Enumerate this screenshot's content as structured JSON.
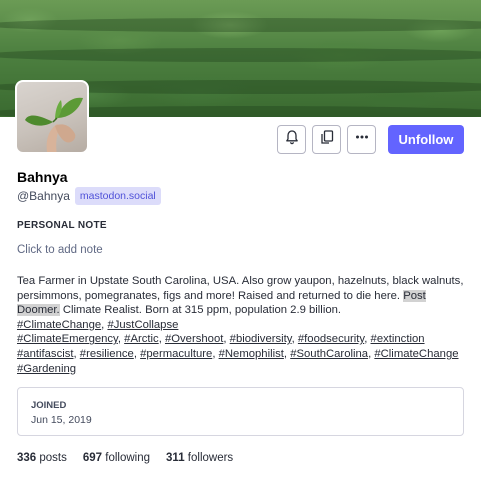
{
  "profile": {
    "display_name": "Bahnya",
    "handle": "@Bahnya",
    "domain": "mastodon.social"
  },
  "actions": {
    "bell_icon": "bell-icon",
    "copy_icon": "copy-icon",
    "more_icon": "ellipsis-icon",
    "unfollow_label": "Unfollow",
    "accent_color": "#6364ff"
  },
  "note": {
    "label": "PERSONAL NOTE",
    "placeholder": "Click to add note"
  },
  "bio": {
    "text_1": "Tea Farmer in Upstate South Carolina, USA. Also grow yaupon, hazelnuts, black walnuts, persimmons, pomegranates, figs and more! Raised and returned to die here.",
    "highlight": "Post Doomer.",
    "text_2": "Climate Realist. Born at 315 ppm, population 2.9 billion.",
    "hashtags_line1": [
      "#ClimateChange",
      "#JustCollapse"
    ],
    "hashtags_line2": [
      "#ClimateEmergency",
      "#Arctic",
      "#Overshoot",
      "#biodiversity",
      "#foodsecurity",
      "#extinction"
    ],
    "hashtags_line3": [
      "#antifascist",
      "#resilience",
      "#permaculture",
      "#Nemophilist",
      "#SouthCarolina",
      "#ClimateChange"
    ],
    "hashtags_line4": [
      "#Gardening"
    ]
  },
  "joined": {
    "label": "JOINED",
    "date": "Jun 15, 2019"
  },
  "stats": {
    "posts_count": "336",
    "posts_label": "posts",
    "following_count": "697",
    "following_label": "following",
    "followers_count": "311",
    "followers_label": "followers"
  }
}
